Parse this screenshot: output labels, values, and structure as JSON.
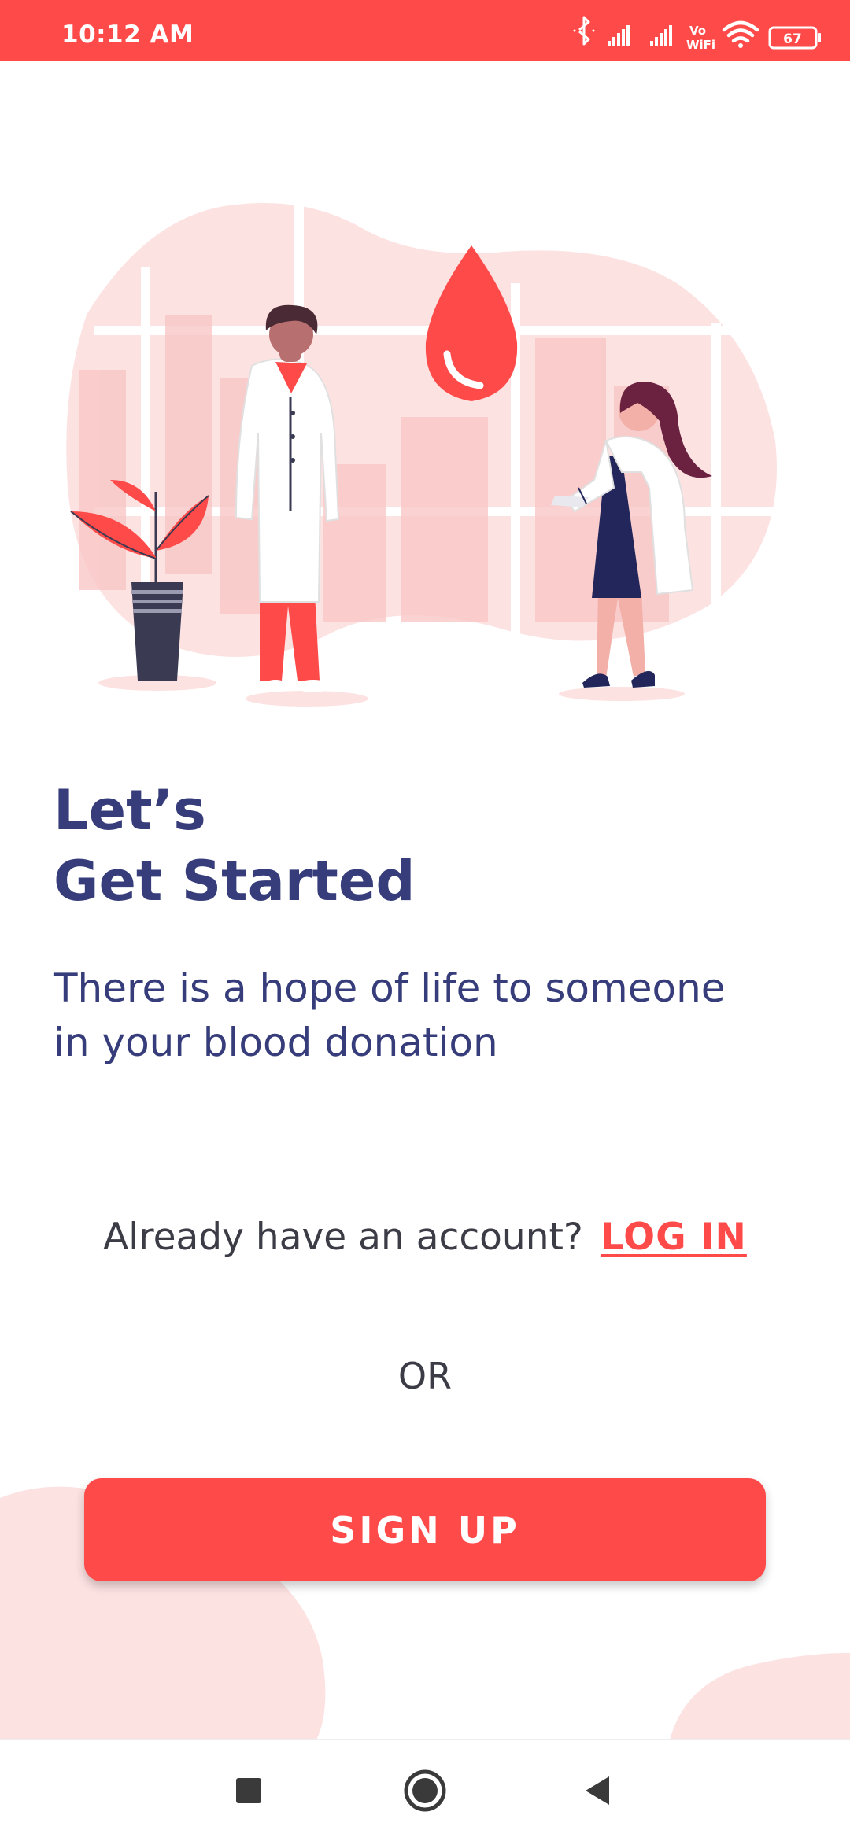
{
  "status_bar": {
    "time": "10:12 AM",
    "battery_level": "67",
    "wifi_label_top": "Vo",
    "wifi_label_bottom": "WiFi",
    "icons": [
      "bluetooth-icon",
      "signal-icon",
      "signal-icon",
      "vowifi-icon",
      "wifi-icon",
      "battery-icon"
    ]
  },
  "colors": {
    "accent": "#ff4a4a",
    "heading": "#363d7a",
    "body_text": "#3c3c46",
    "blob": "#fde2e2"
  },
  "hero": {
    "illustration": "blood-donation-doctors-illustration"
  },
  "main": {
    "heading_line1": "Let’s",
    "heading_line2": "Get Started",
    "tagline_line1": "There is a hope of life to someone",
    "tagline_line2": "in your blood donation",
    "login_prompt": "Already have an account?",
    "login_link": "LOG IN",
    "or_text": "OR",
    "signup_label": "SIGN UP"
  },
  "nav_bar": {
    "buttons": [
      "recent-apps-icon",
      "home-icon",
      "back-icon"
    ]
  }
}
